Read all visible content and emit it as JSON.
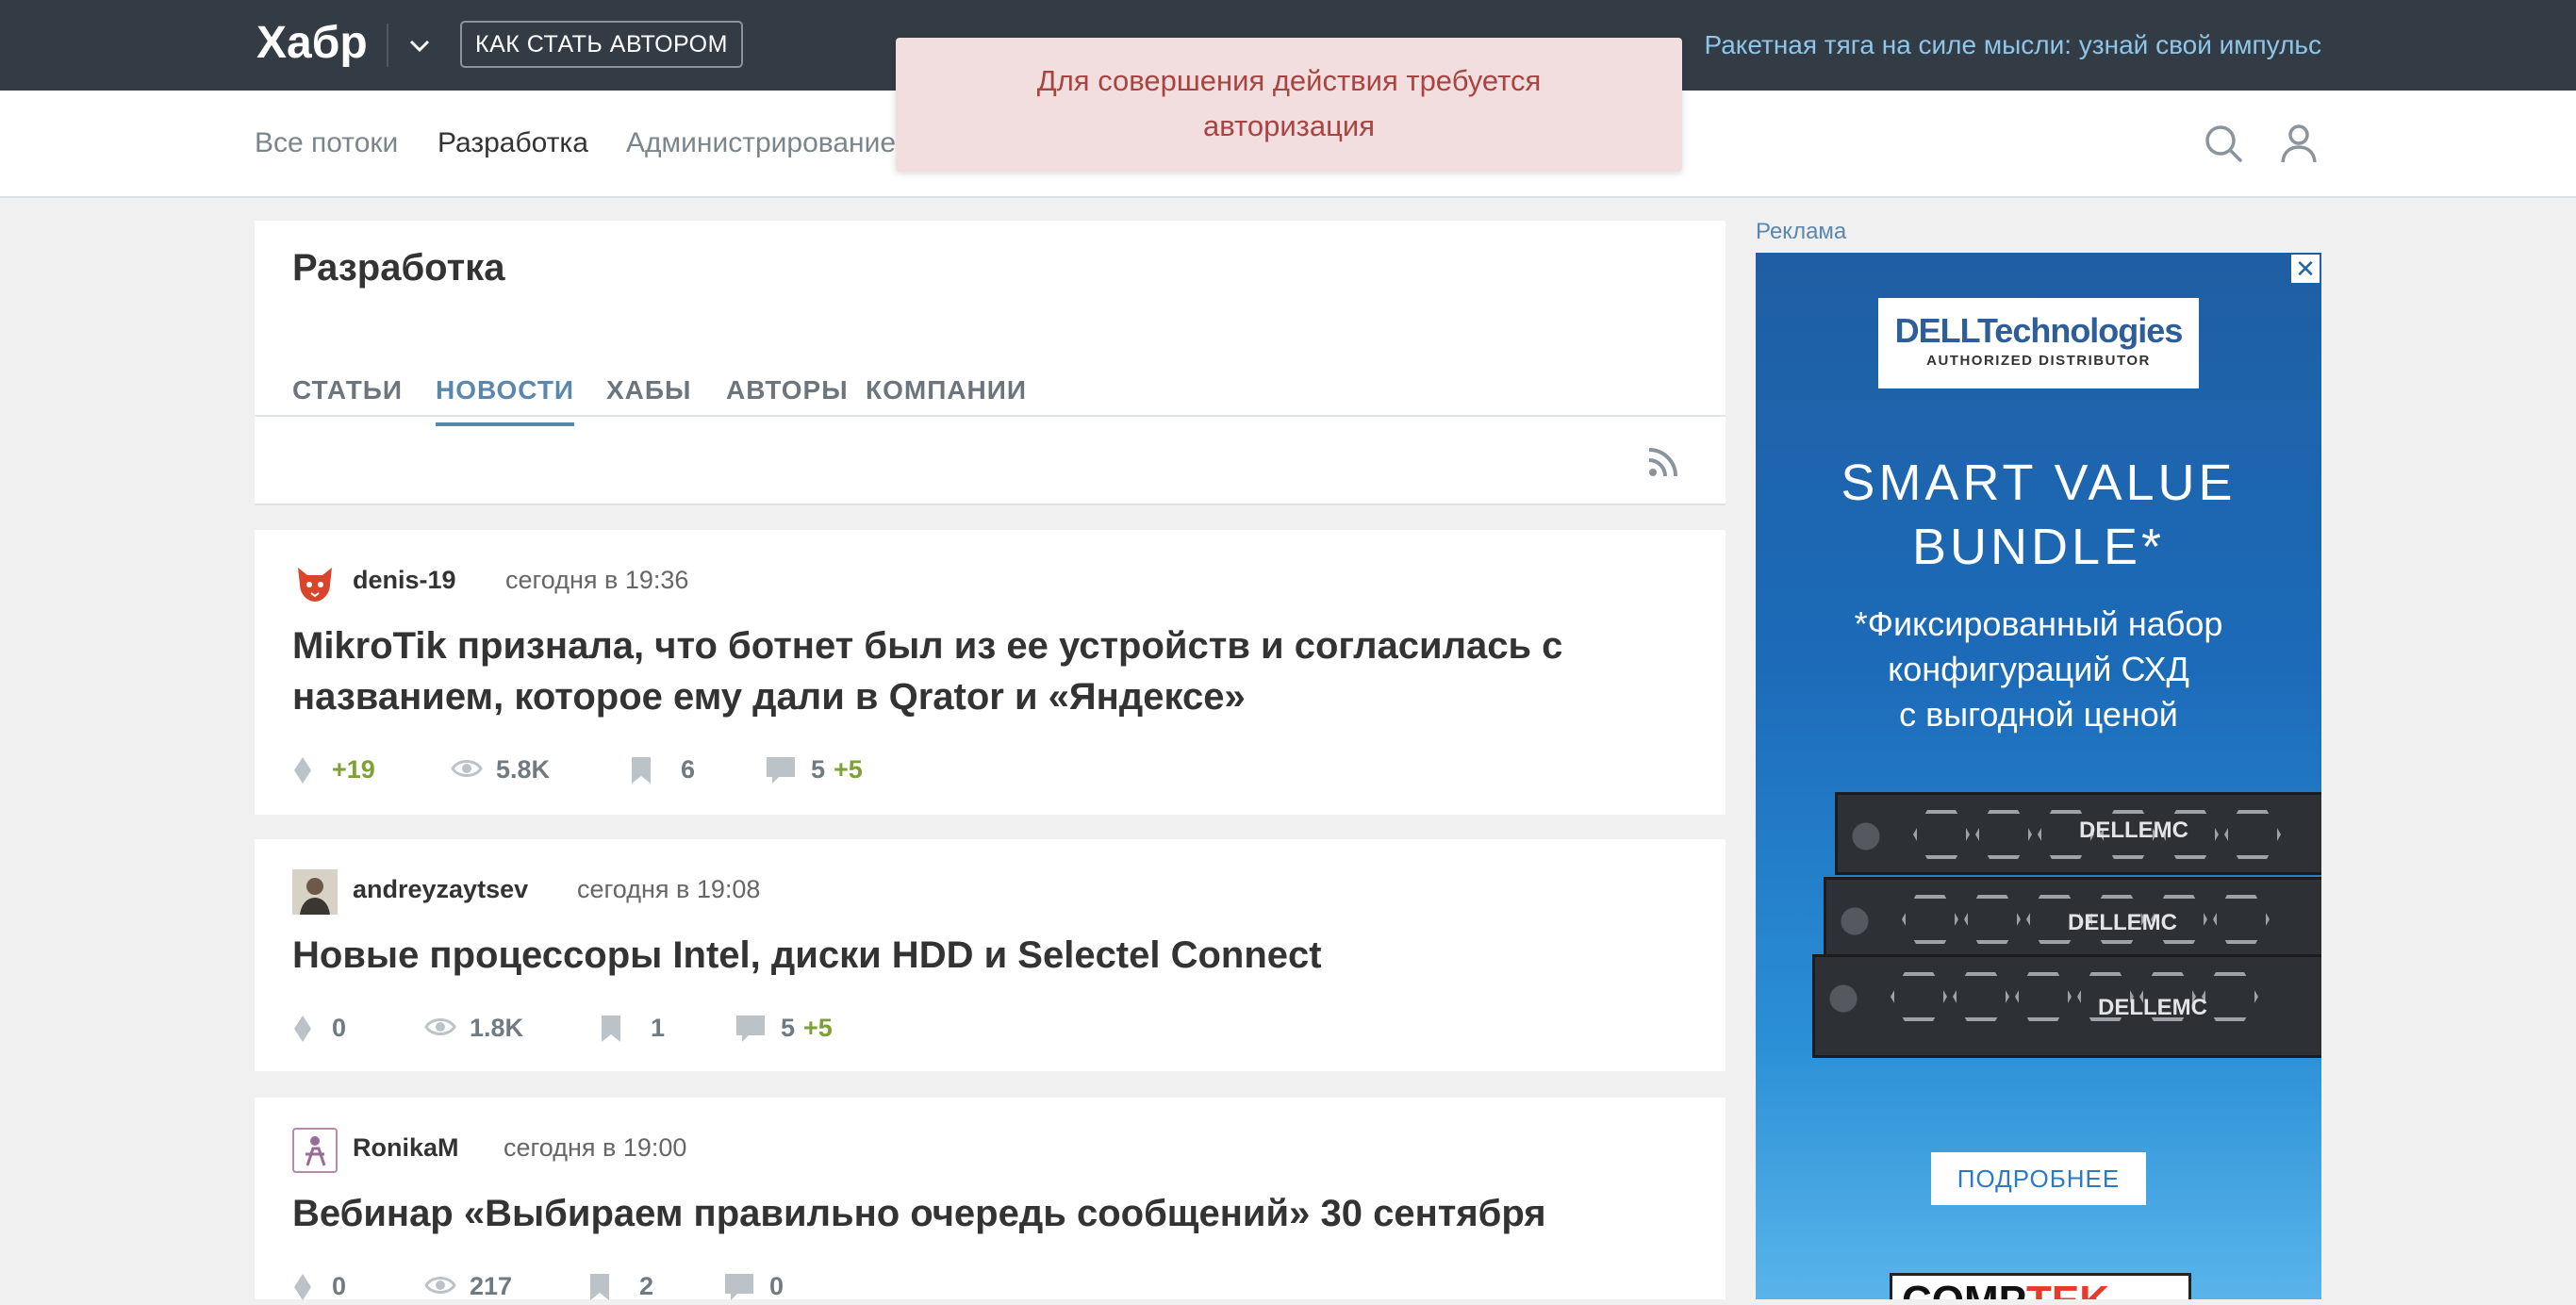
{
  "header": {
    "logo": "Хабр",
    "become_author": "КАК СТАТЬ АВТОРОМ",
    "promo": "Ракетная тяга на силе мысли: узнай свой импульс"
  },
  "nav": {
    "items": [
      "Все потоки",
      "Разработка",
      "Администрирование"
    ],
    "active": "Разработка"
  },
  "toast": {
    "line1": "Для совершения действия требуется",
    "line2": "авторизация"
  },
  "hub": {
    "title": "Разработка",
    "tabs": [
      "СТАТЬИ",
      "НОВОСТИ",
      "ХАБЫ",
      "АВТОРЫ",
      "КОМПАНИИ"
    ],
    "active_tab": "НОВОСТИ"
  },
  "posts": [
    {
      "author": "denis-19",
      "date": "сегодня в 19:36",
      "title": "MikroTik признала, что ботнет был из ее устройств и согласилась с названием, которое ему дали в Qrator и «Яндексе»",
      "rating": "+19",
      "views": "5.8K",
      "bookmarks": "6",
      "comments": "5",
      "new_comments": "+5"
    },
    {
      "author": "andreyzaytsev",
      "date": "сегодня в 19:08",
      "title": "Новые процессоры Intel, диски HDD и Selectel Connect",
      "rating": "0",
      "views": "1.8K",
      "bookmarks": "1",
      "comments": "5",
      "new_comments": "+5"
    },
    {
      "author": "RonikaM",
      "date": "сегодня в 19:00",
      "title": "Вебинар «Выбираем правильно очередь сообщений» 30 сентября",
      "rating": "0",
      "views": "217",
      "bookmarks": "2",
      "comments": "0",
      "new_comments": ""
    }
  ],
  "ad": {
    "label": "Реклама",
    "close": "✕",
    "dell_name": "DELLTechnologies",
    "dell_sub": "AUTHORIZED DISTRIBUTOR",
    "headline_1": "SMART VALUE",
    "headline_2": "BUNDLE*",
    "body_1": "*Фиксированный набор",
    "body_2": "конфигураций СХД",
    "body_3": "с выгодной ценой",
    "rack_brand_1": "DELLEMC",
    "rack_brand_2": "DELLEMC",
    "rack_brand_3": "DELLEMC",
    "button": "ПОДРОБНЕЕ",
    "logo_a": "COMP",
    "logo_b": "TEK"
  },
  "colors": {
    "header_bg": "#333c45",
    "accent": "#5a87ad",
    "positive": "#7ea135",
    "toast_bg": "#f2dede",
    "toast_text": "#a94442"
  }
}
